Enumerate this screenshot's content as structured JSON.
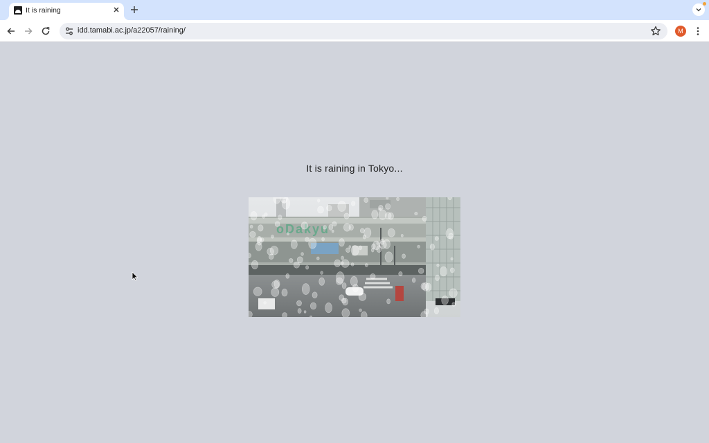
{
  "browser": {
    "tab": {
      "title": "It is raining"
    },
    "url": "idd.tamabi.ac.jp/a22057/raining/",
    "profile_initial": "M",
    "icons": {
      "favicon": "site-favicon-icon",
      "close": "close-icon",
      "new_tab": "plus-icon",
      "tab_search": "chevron-down-icon",
      "back": "arrow-left-icon",
      "forward": "arrow-right-icon",
      "reload": "reload-icon",
      "site_info": "tune-icon",
      "bookmark": "star-icon",
      "menu": "kebab-menu-icon"
    },
    "colors": {
      "tabstrip": "#d3e3fd",
      "avatar": "#e05a2b",
      "notification_dot": "#f2a23a"
    }
  },
  "page": {
    "headline": "It is raining in Tokyo...",
    "background": "#d1d4dc"
  }
}
